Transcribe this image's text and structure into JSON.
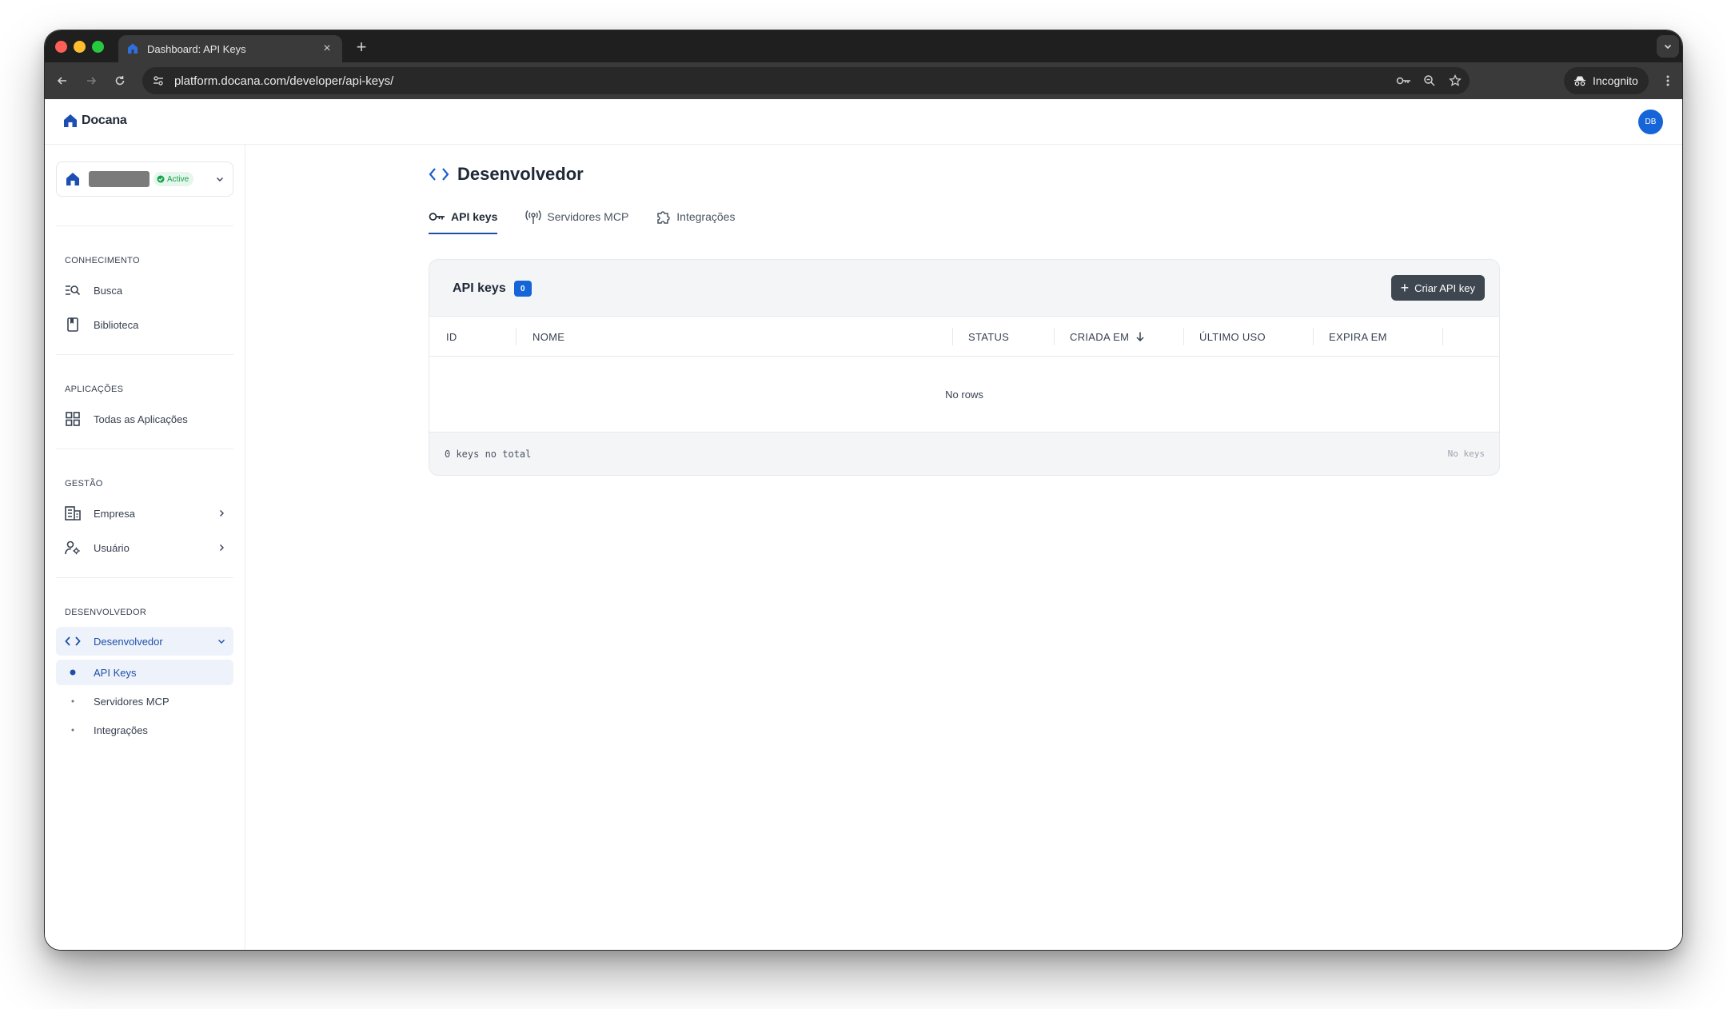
{
  "browser": {
    "tab_title": "Dashboard: API Keys",
    "url": "platform.docana.com/developer/api-keys/",
    "incognito_label": "Incognito"
  },
  "app": {
    "logo_text": "Docana",
    "avatar_initials": "DB"
  },
  "org": {
    "status": "Active"
  },
  "sidebar": {
    "sections": [
      {
        "title": "CONHECIMENTO",
        "items": [
          {
            "label": "Busca",
            "icon": "search-list-icon"
          },
          {
            "label": "Biblioteca",
            "icon": "book-icon"
          }
        ]
      },
      {
        "title": "APLICAÇÕES",
        "items": [
          {
            "label": "Todas as Aplicações",
            "icon": "grid-icon"
          }
        ]
      },
      {
        "title": "GESTÃO",
        "items": [
          {
            "label": "Empresa",
            "icon": "building-icon"
          },
          {
            "label": "Usuário",
            "icon": "user-settings-icon"
          }
        ]
      },
      {
        "title": "DESENVOLVEDOR",
        "items": [
          {
            "label": "Desenvolvedor",
            "icon": "code-icon"
          }
        ]
      }
    ],
    "subitems": [
      "API Keys",
      "Servidores MCP",
      "Integrações"
    ]
  },
  "page": {
    "title": "Desenvolvedor",
    "tabs": [
      "API keys",
      "Servidores MCP",
      "Integrações"
    ]
  },
  "card": {
    "title": "API keys",
    "count": "0",
    "create_label": "Criar API key",
    "columns": [
      "ID",
      "NOME",
      "STATUS",
      "CRIADA EM",
      "ÚLTIMO USO",
      "EXPIRA EM"
    ],
    "empty_text": "No rows",
    "footer_left": "0 keys no total",
    "footer_right": "No keys"
  },
  "colors": {
    "accent": "#1565d8",
    "active_text": "#1e4fa8",
    "button_bg": "#3e4650",
    "badge_green": "#16a34a"
  }
}
